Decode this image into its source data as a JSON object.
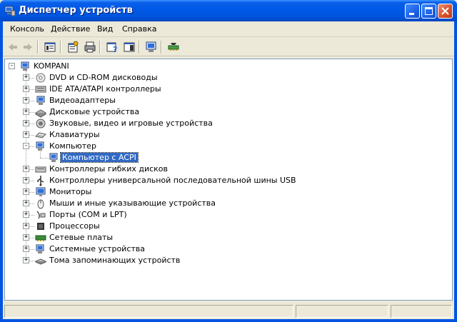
{
  "window": {
    "title": "Диспетчер устройств"
  },
  "menu": [
    {
      "label": "Консоль"
    },
    {
      "label": "Действие"
    },
    {
      "label": "Вид"
    },
    {
      "label": "Справка"
    }
  ],
  "tree": {
    "root": "KOMPANI",
    "items": [
      {
        "label": "DVD и CD-ROM дисководы",
        "icon": "cdrom-icon",
        "expander": "+"
      },
      {
        "label": "IDE ATA/ATAPI контроллеры",
        "icon": "ide-controller-icon",
        "expander": "+"
      },
      {
        "label": "Видеоадаптеры",
        "icon": "display-adapter-icon",
        "expander": "+"
      },
      {
        "label": "Дисковые устройства",
        "icon": "disk-drive-icon",
        "expander": "+"
      },
      {
        "label": "Звуковые, видео и игровые устройства",
        "icon": "sound-icon",
        "expander": "+"
      },
      {
        "label": "Клавиатуры",
        "icon": "keyboard-icon",
        "expander": "+"
      },
      {
        "label": "Компьютер",
        "icon": "computer-icon",
        "expander": "-"
      },
      {
        "label": "Компьютер с ACPI",
        "icon": "computer-icon",
        "child": true,
        "selected": true
      },
      {
        "label": "Контроллеры гибких дисков",
        "icon": "floppy-controller-icon",
        "expander": "+"
      },
      {
        "label": "Контроллеры универсальной последовательной шины USB",
        "icon": "usb-icon",
        "expander": "+"
      },
      {
        "label": "Мониторы",
        "icon": "monitor-icon",
        "expander": "+"
      },
      {
        "label": "Мыши и иные указывающие устройства",
        "icon": "mouse-icon",
        "expander": "+"
      },
      {
        "label": "Порты (COM и LPT)",
        "icon": "port-icon",
        "expander": "+"
      },
      {
        "label": "Процессоры",
        "icon": "processor-icon",
        "expander": "+"
      },
      {
        "label": "Сетевые платы",
        "icon": "network-card-icon",
        "expander": "+"
      },
      {
        "label": "Системные устройства",
        "icon": "system-device-icon",
        "expander": "+"
      },
      {
        "label": "Тома запоминающих устройств",
        "icon": "storage-volume-icon",
        "expander": "+"
      }
    ]
  },
  "colors": {
    "titlebar": "#0058E6",
    "selection": "#316AC5",
    "chrome": "#ECE9D8"
  }
}
